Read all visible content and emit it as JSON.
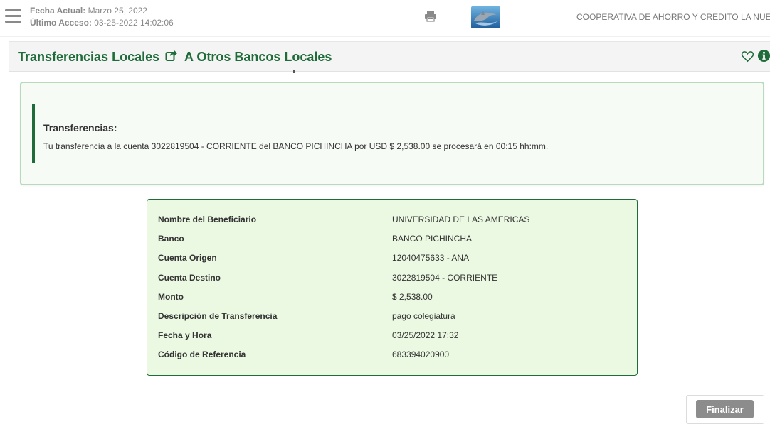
{
  "header": {
    "fecha_actual_label": "Fecha Actual:",
    "fecha_actual_value": "Marzo 25, 2022",
    "ultimo_acceso_label": "Último Acceso:",
    "ultimo_acceso_value": "03-25-2022 14:02:06",
    "coop_name": "COOPERATIVA DE AHORRO Y CREDITO LA NUE"
  },
  "page": {
    "title": "Transferencias Locales",
    "subtitle": "A Otros Bancos Locales"
  },
  "alert": {
    "title": "Transferencias:",
    "message": "Tu transferencia a la cuenta 3022819504 - CORRIENTE del BANCO PICHINCHA por USD $ 2,538.00 se procesará en 00:15 hh:mm."
  },
  "details": [
    {
      "label": "Nombre del Beneficiario",
      "value": "UNIVERSIDAD DE LAS AMERICAS"
    },
    {
      "label": "Banco",
      "value": "BANCO PICHINCHA"
    },
    {
      "label": "Cuenta Origen",
      "value": "12040475633 - ANA"
    },
    {
      "label": "Cuenta Destino",
      "value": "3022819504 - CORRIENTE"
    },
    {
      "label": "Monto",
      "value": "$ 2,538.00"
    },
    {
      "label": "Descripción de Transferencia",
      "value": "pago colegiatura"
    },
    {
      "label": "Fecha y Hora",
      "value": "03/25/2022 17:32"
    },
    {
      "label": "Código de Referencia",
      "value": "683394020900"
    }
  ],
  "actions": {
    "finalizar_label": "Finalizar"
  },
  "colors": {
    "brand_green": "#1f6b3a",
    "details_bg": "#ebf8e2",
    "button_gray": "#8c8c8c"
  }
}
